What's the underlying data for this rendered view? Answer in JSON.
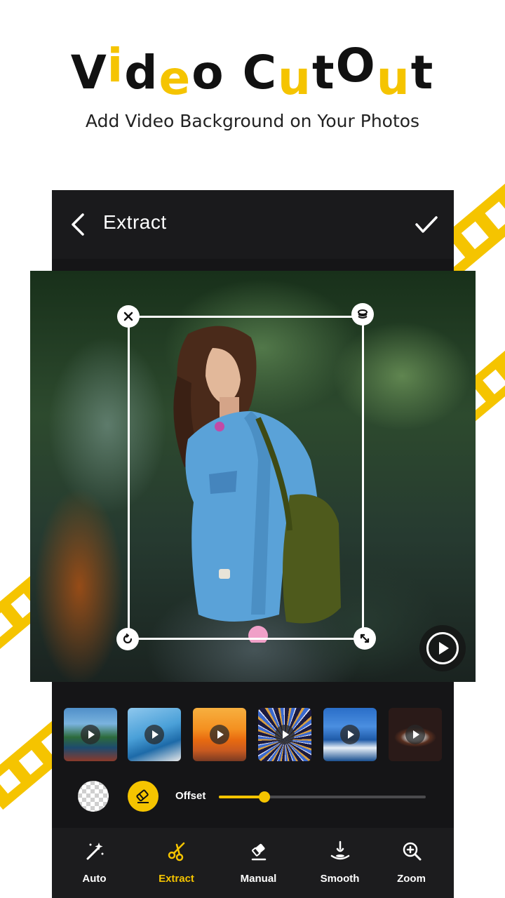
{
  "hero": {
    "title_line": "Video CutOut",
    "subtitle": "Add Video Background on Your Photos"
  },
  "editor": {
    "screen_title": "Extract",
    "offset_label": "Offset",
    "offset_value_percent": 22
  },
  "thumbnails": [
    {
      "name": "coastal-rocks-boat"
    },
    {
      "name": "sailboat-sea"
    },
    {
      "name": "sunset-ocean"
    },
    {
      "name": "ferris-wheel-lights"
    },
    {
      "name": "boat-blue-sea"
    },
    {
      "name": "stadium-eye"
    }
  ],
  "tabs": [
    {
      "label": "Auto",
      "icon": "magic-wand-icon",
      "active": false
    },
    {
      "label": "Extract",
      "icon": "scissors-icon",
      "active": true
    },
    {
      "label": "Manual",
      "icon": "eraser-icon",
      "active": false
    },
    {
      "label": "Smooth",
      "icon": "droplet-icon",
      "active": false
    },
    {
      "label": "Zoom",
      "icon": "zoom-in-icon",
      "active": false
    }
  ],
  "colors": {
    "accent": "#f5c400",
    "panel": "#151517",
    "text_dark": "#111111"
  }
}
